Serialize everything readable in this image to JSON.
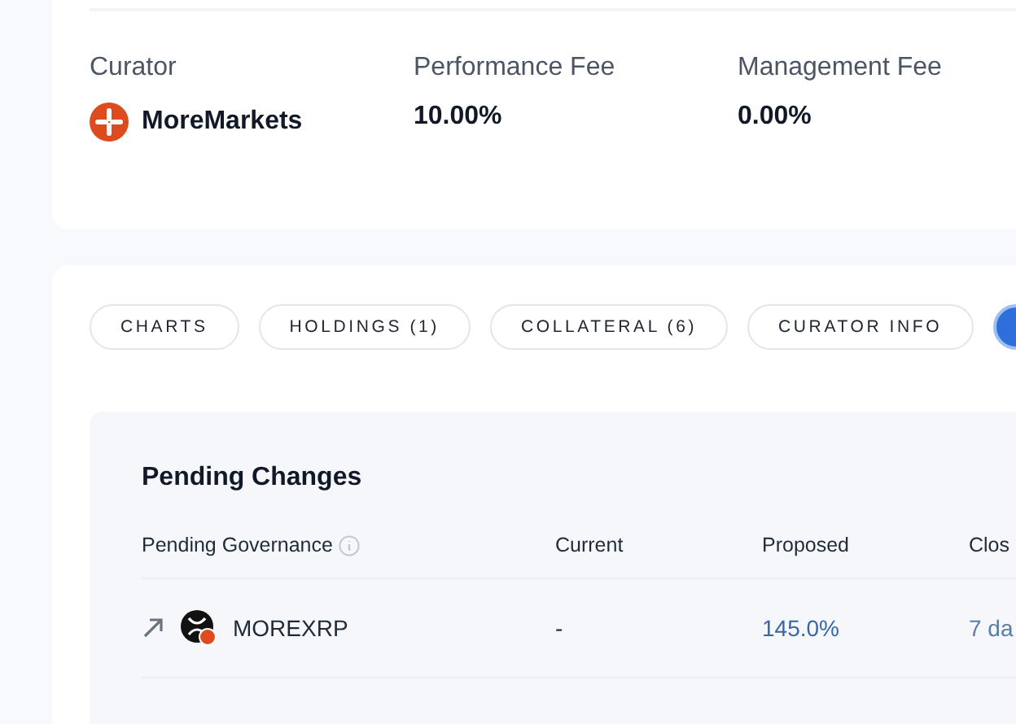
{
  "summary": {
    "fields": [
      {
        "label": "Curator",
        "value": "MoreMarkets",
        "kind": "curator"
      },
      {
        "label": "Performance Fee",
        "value": "10.00%",
        "kind": "plain"
      },
      {
        "label": "Management Fee",
        "value": "0.00%",
        "kind": "plain"
      }
    ]
  },
  "tabs": [
    {
      "label": "CHARTS",
      "selected": false
    },
    {
      "label": "HOLDINGS (1)",
      "selected": false
    },
    {
      "label": "COLLATERAL (6)",
      "selected": false
    },
    {
      "label": "CURATOR INFO",
      "selected": false
    }
  ],
  "pending": {
    "title": "Pending Changes",
    "columns": [
      "Pending Governance",
      "Current",
      "Proposed",
      "Clos"
    ],
    "rows": [
      {
        "asset": "MOREXRP",
        "current": "-",
        "proposed": "145.0%",
        "column_4": "7 da"
      }
    ]
  }
}
